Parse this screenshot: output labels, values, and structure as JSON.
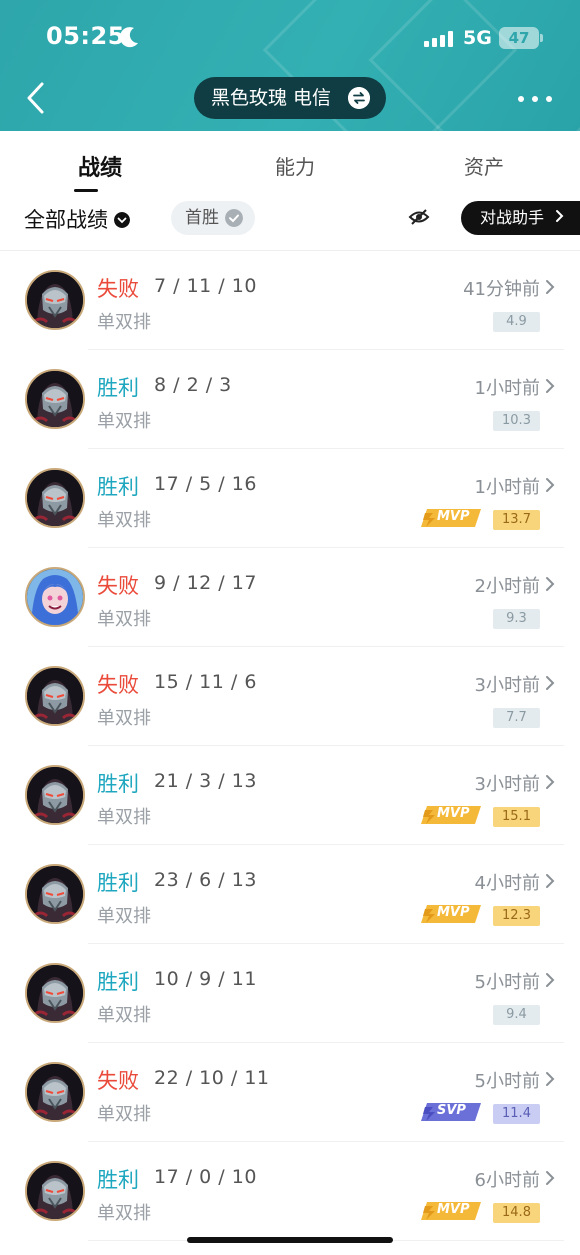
{
  "status": {
    "time": "05:25",
    "network": "5G",
    "battery": "47"
  },
  "header": {
    "account": "黑色玫瑰 电信"
  },
  "tabs": [
    {
      "label": "战绩"
    },
    {
      "label": "能力"
    },
    {
      "label": "资产"
    }
  ],
  "filter": {
    "all_label": "全部战绩",
    "chip_label": "首胜",
    "assist_label": "对战助手"
  },
  "matches": [
    {
      "result": "失败",
      "kda": "7 / 11 / 10",
      "mode": "单双排",
      "ago": "41分钟前",
      "score": "4.9",
      "badge": "",
      "hero": "mask"
    },
    {
      "result": "胜利",
      "kda": "8 / 2 / 3",
      "mode": "单双排",
      "ago": "1小时前",
      "score": "10.3",
      "badge": "",
      "hero": "mask"
    },
    {
      "result": "胜利",
      "kda": "17 / 5 / 16",
      "mode": "单双排",
      "ago": "1小时前",
      "score": "13.7",
      "badge": "MVP",
      "hero": "mask"
    },
    {
      "result": "失败",
      "kda": "9 / 12 / 17",
      "mode": "单双排",
      "ago": "2小时前",
      "score": "9.3",
      "badge": "",
      "hero": "jinx"
    },
    {
      "result": "失败",
      "kda": "15 / 11 / 6",
      "mode": "单双排",
      "ago": "3小时前",
      "score": "7.7",
      "badge": "",
      "hero": "mask"
    },
    {
      "result": "胜利",
      "kda": "21 / 3 / 13",
      "mode": "单双排",
      "ago": "3小时前",
      "score": "15.1",
      "badge": "MVP",
      "hero": "mask"
    },
    {
      "result": "胜利",
      "kda": "23 / 6 / 13",
      "mode": "单双排",
      "ago": "4小时前",
      "score": "12.3",
      "badge": "MVP",
      "hero": "mask"
    },
    {
      "result": "胜利",
      "kda": "10 / 9 / 11",
      "mode": "单双排",
      "ago": "5小时前",
      "score": "9.4",
      "badge": "",
      "hero": "mask"
    },
    {
      "result": "失败",
      "kda": "22 / 10 / 11",
      "mode": "单双排",
      "ago": "5小时前",
      "score": "11.4",
      "badge": "SVP",
      "hero": "mask"
    },
    {
      "result": "胜利",
      "kda": "17 / 0 / 10",
      "mode": "单双排",
      "ago": "6小时前",
      "score": "14.8",
      "badge": "MVP",
      "hero": "mask"
    }
  ],
  "colors": {
    "header": "#2ea6ab",
    "win": "#1fa7c0",
    "loss": "#ea4a3a",
    "mvp": "#f8d47a",
    "svp": "#c9cdf3"
  }
}
